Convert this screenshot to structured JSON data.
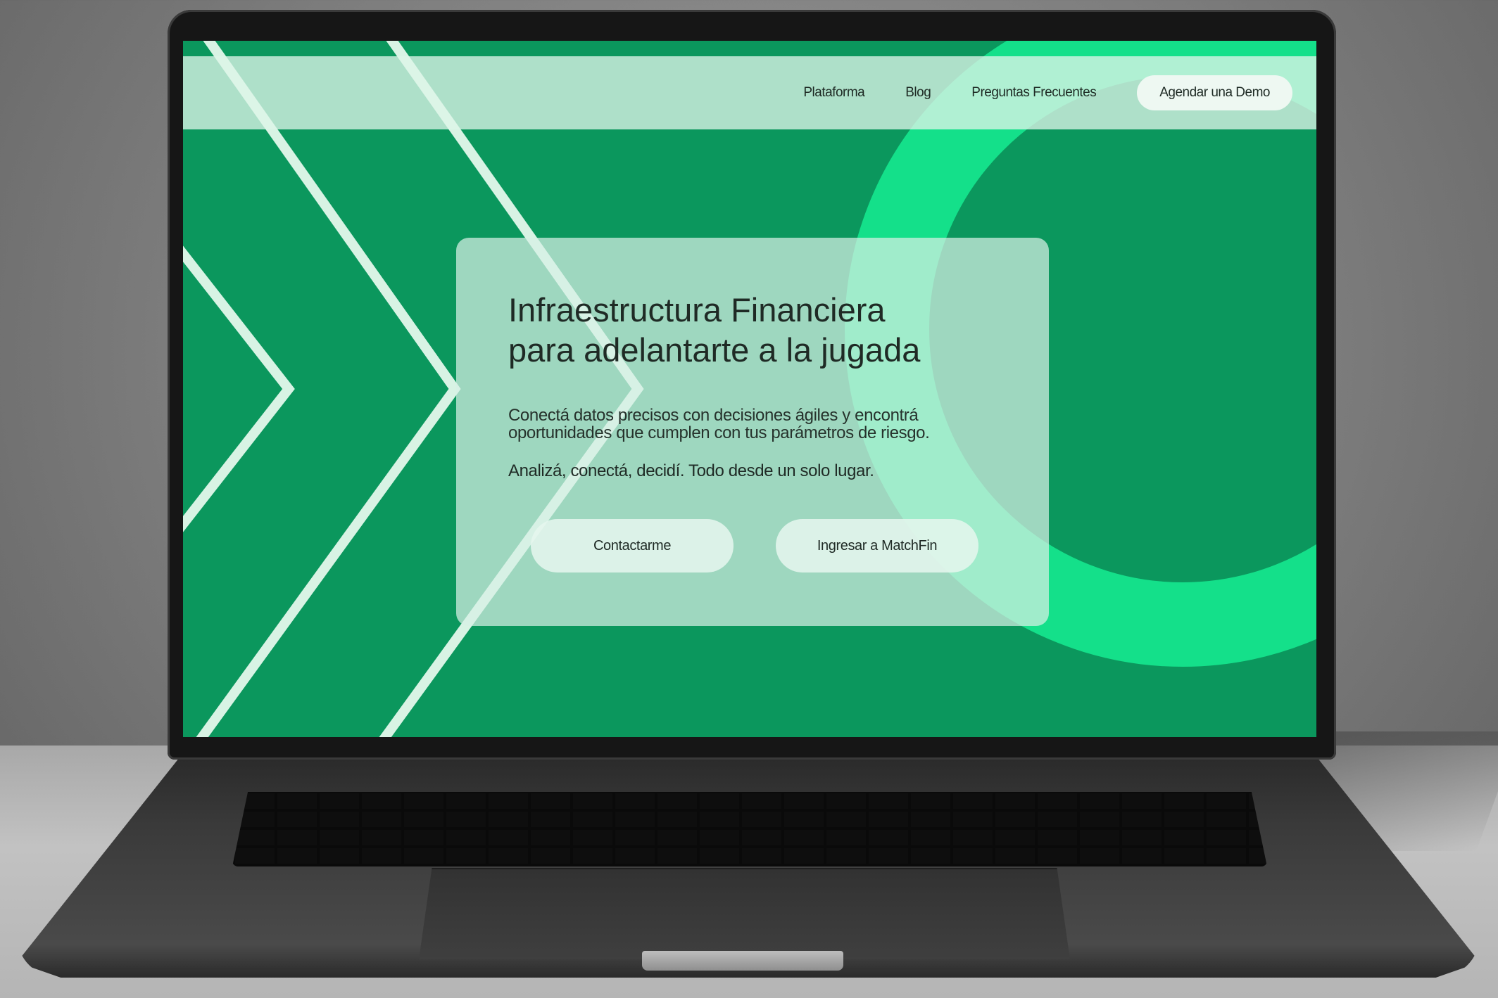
{
  "nav": {
    "links": [
      {
        "label": "Plataforma"
      },
      {
        "label": "Blog"
      },
      {
        "label": "Preguntas Frecuentes"
      }
    ],
    "demo_button": "Agendar una Demo"
  },
  "hero": {
    "title_line1": "Infraestructura Financiera",
    "title_line2": "para adelantarte a la jugada",
    "subtitle_line1": "Conectá datos precisos con decisiones ágiles y encontrá",
    "subtitle_line2": "oportunidades que cumplen con tus parámetros de riesgo.",
    "tagline": "Analizá, conectá, decidí. Todo desde un solo lugar.",
    "primary_button": "Contactarme",
    "secondary_button": "Ingresar a MatchFin"
  },
  "colors": {
    "brand_green": "#0b975d",
    "accent_green": "#14e08a",
    "stripe": "#d8f3e4"
  }
}
